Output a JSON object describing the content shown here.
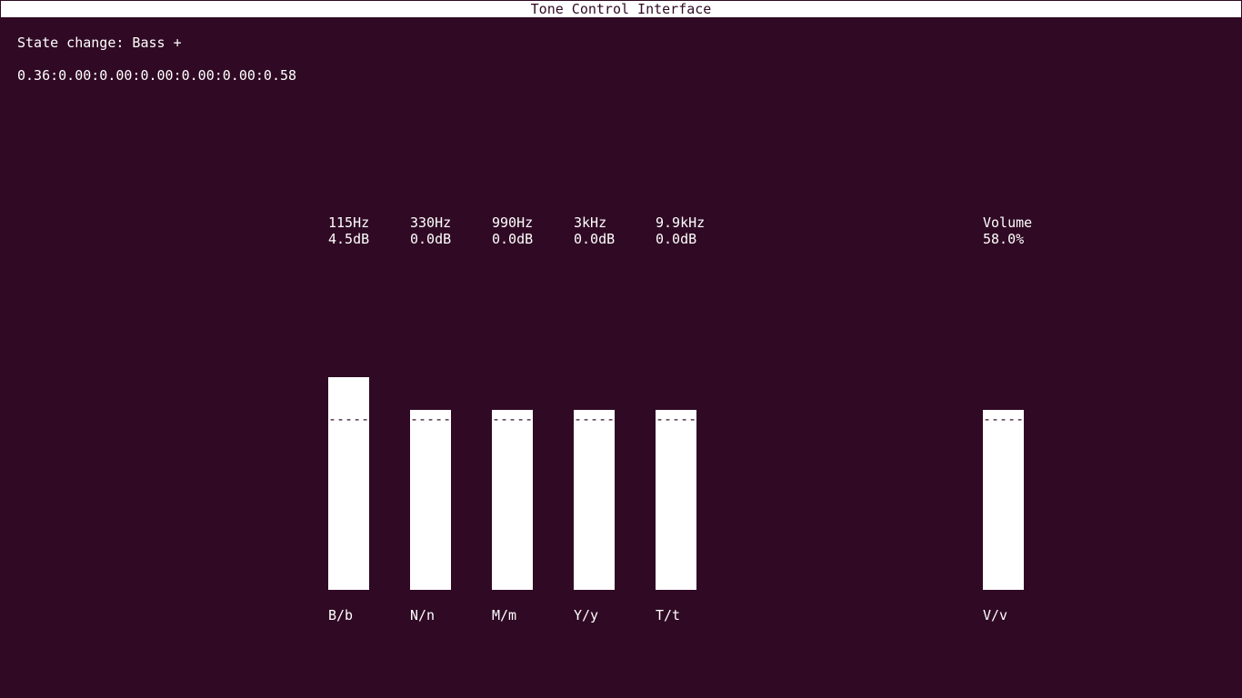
{
  "window": {
    "title": "Tone Control Interface"
  },
  "status": {
    "state_change": "State change: Bass +",
    "values_line": "0.36:0.00:0.00:0.00:0.00:0.00:0.58"
  },
  "bands": [
    {
      "frequency": "115Hz",
      "level": "4.5dB",
      "key": "B/b",
      "marker": "-----"
    },
    {
      "frequency": "330Hz",
      "level": "0.0dB",
      "key": "N/n",
      "marker": "-----"
    },
    {
      "frequency": "990Hz",
      "level": "0.0dB",
      "key": "M/m",
      "marker": "-----"
    },
    {
      "frequency": "3kHz",
      "level": "0.0dB",
      "key": "Y/y",
      "marker": "-----"
    },
    {
      "frequency": "9.9kHz",
      "level": "0.0dB",
      "key": "T/t",
      "marker": "-----"
    }
  ],
  "volume": {
    "label": "Volume",
    "level": "58.0%",
    "key": "V/v",
    "marker": "-----"
  },
  "colors": {
    "background": "#300a24",
    "foreground": "#ffffff"
  }
}
